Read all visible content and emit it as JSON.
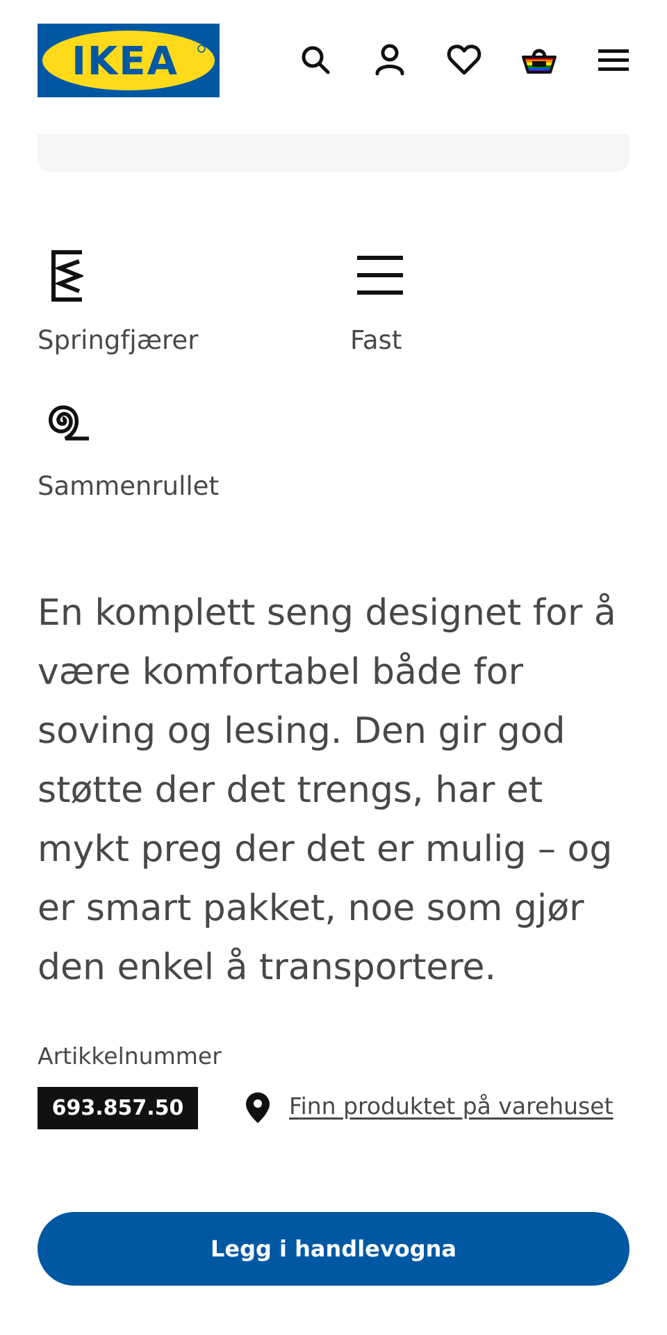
{
  "header": {
    "logo_text": "IKEA",
    "icons": [
      "search-icon",
      "account-icon",
      "favorites-heart-icon",
      "shopping-basket-icon",
      "menu-hamburger-icon"
    ]
  },
  "features": [
    {
      "icon": "spring-coil-icon",
      "label": "Springfjærer"
    },
    {
      "icon": "firmness-firm-icon",
      "label": "Fast"
    },
    {
      "icon": "rolled-package-icon",
      "label": "Sammenrullet"
    }
  ],
  "description": "En komplett seng designet for å være komfortabel både for soving og lesing. Den gir god støtte der det trengs, har et mykt preg der det er mulig – og er smart pakket, noe som gjør den enkel å transportere.",
  "article": {
    "label": "Artikkelnummer",
    "number": "693.857.50"
  },
  "store_link": "Finn produktet på varehuset",
  "cart_button": "Legg i handlevogna",
  "colors": {
    "brand_blue": "#0058a3",
    "brand_yellow": "#ffda1a",
    "text": "#484848",
    "panel": "#f5f5f5"
  }
}
